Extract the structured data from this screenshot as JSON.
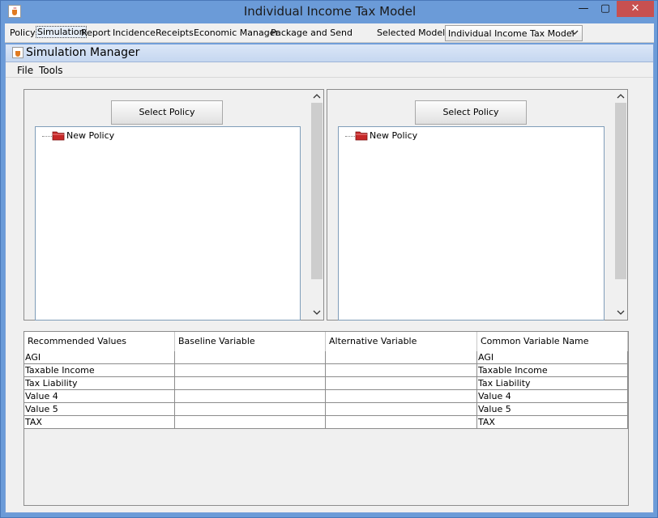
{
  "window": {
    "title": "Individual Income Tax Model",
    "minimize_glyph": "—",
    "maximize_glyph": "▢",
    "close_glyph": "✕"
  },
  "menubar": {
    "items": [
      "Policy",
      "Simulation",
      "Report",
      "Incidence",
      "Receipts",
      "Economic Manager",
      "Package and Send"
    ],
    "selected_model_label": "Selected Model:",
    "selected_model_value": "Individual Income Tax Model"
  },
  "internal_frame": {
    "title": "Simulation Manager",
    "menu_items": [
      "File",
      "Tools"
    ]
  },
  "policy_panels": {
    "left": {
      "button_label": "Select Policy",
      "tree_root": "New Policy"
    },
    "right": {
      "button_label": "Select Policy",
      "tree_root": "New Policy"
    }
  },
  "table": {
    "columns": [
      "Recommended Values",
      "Baseline Variable",
      "Alternative Variable",
      "Common Variable Name"
    ],
    "rows": [
      [
        "AGI",
        "",
        "",
        "AGI"
      ],
      [
        "Taxable Income",
        "",
        "",
        "Taxable Income"
      ],
      [
        "Tax Liability",
        "",
        "",
        "Tax Liability"
      ],
      [
        "Value 4",
        "",
        "",
        "Value 4"
      ],
      [
        "Value 5",
        "",
        "",
        "Value 5"
      ],
      [
        "TAX",
        "",
        "",
        "TAX"
      ]
    ]
  },
  "icons": {
    "app": "java-coffee-icon",
    "folder": "red-folder-icon"
  },
  "colors": {
    "window_frame": "#6b9bd8",
    "close_button": "#c75050",
    "panel_bg": "#f0f0f0"
  }
}
